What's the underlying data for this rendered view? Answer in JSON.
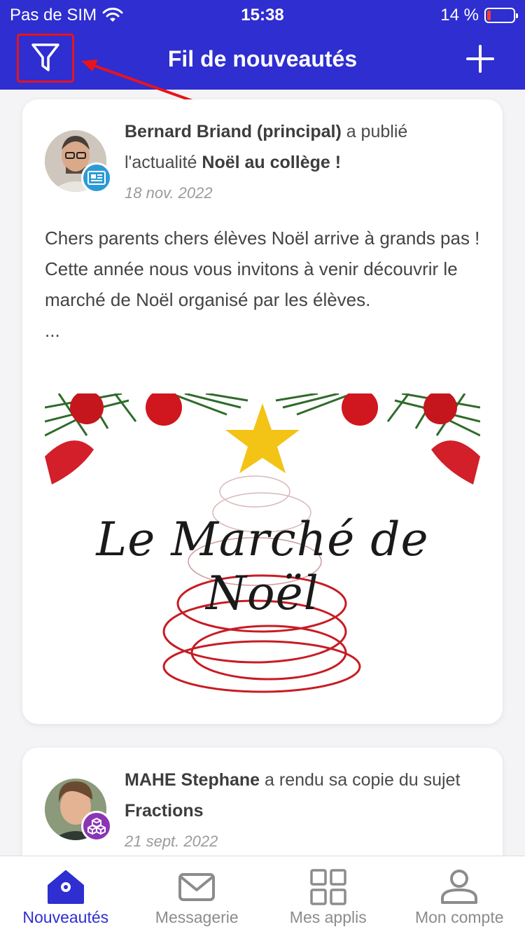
{
  "status_bar": {
    "carrier": "Pas de SIM",
    "time": "15:38",
    "battery": "14 %"
  },
  "header": {
    "title": "Fil de nouveautés",
    "filter_icon": "filter-icon",
    "add_icon": "plus-icon"
  },
  "feed": [
    {
      "author": "Bernard Briand (principal)",
      "action": " a publié l'actualité ",
      "subject": "Noël au collège !",
      "date": "18 nov. 2022",
      "body": [
        "Chers parents chers élèves Noël arrive à grands pas !",
        "Cette année nous vous invitons à venir découvrir le marché de Noël organisé par les élèves.",
        "..."
      ],
      "image_text": "Le Marché de Noël",
      "badge_icon": "newspaper-icon"
    },
    {
      "author": "MAHE Stephane",
      "action": " a rendu sa copie du sujet ",
      "subject": "Fractions",
      "date": "21 sept. 2022",
      "badge_icon": "cubes-icon"
    }
  ],
  "tabs": [
    {
      "label": "Nouveautés",
      "icon": "home-icon",
      "active": true
    },
    {
      "label": "Messagerie",
      "icon": "mail-icon",
      "active": false
    },
    {
      "label": "Mes applis",
      "icon": "grid-icon",
      "active": false
    },
    {
      "label": "Mon compte",
      "icon": "user-icon",
      "active": false
    }
  ],
  "colors": {
    "primary": "#2e2ed1",
    "highlight": "#e8141b"
  }
}
